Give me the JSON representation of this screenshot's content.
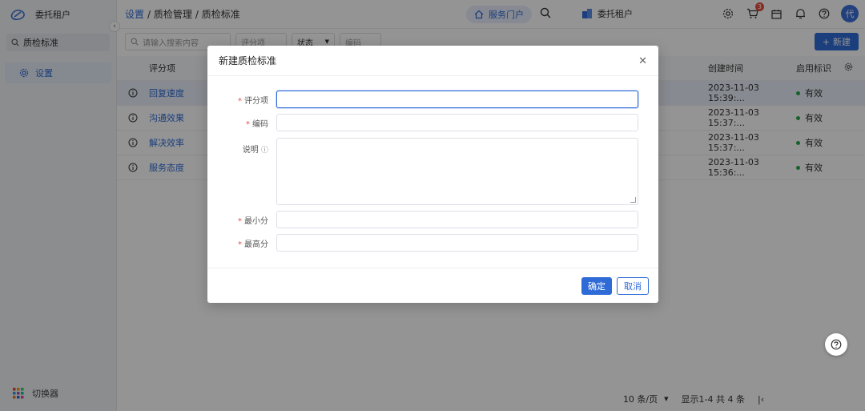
{
  "sidebar": {
    "tenant": "委托租户",
    "search_value": "质检标准",
    "menu_item": "设置",
    "switcher": "切换器"
  },
  "header": {
    "breadcrumb": [
      "设置",
      "/ 质检管理",
      "/ 质检标准"
    ],
    "portal": "服务门户",
    "tenant": "委托租户",
    "cart_badge": "3",
    "avatar": "代"
  },
  "toolbar": {
    "search_placeholder": "请输入搜索内容",
    "filter_score_item": "评分项",
    "filter_status": "状态",
    "filter_code": "编码",
    "new_button": "新建"
  },
  "table": {
    "headers": {
      "name": "评分项",
      "created": "创建时间",
      "flag": "启用标识"
    },
    "rows": [
      {
        "name": "回复速度",
        "created": "2023-11-03 15:39:...",
        "flag": "有效"
      },
      {
        "name": "沟通效果",
        "created": "2023-11-03 15:37:...",
        "flag": "有效"
      },
      {
        "name": "解决效率",
        "created": "2023-11-03 15:37:...",
        "flag": "有效"
      },
      {
        "name": "服务态度",
        "created": "2023-11-03 15:36:...",
        "flag": "有效"
      }
    ]
  },
  "footer": {
    "page_size": "10 条/页",
    "summary": "显示1-4 共 4 条"
  },
  "modal": {
    "title": "新建质检标准",
    "fields": {
      "score_item": "评分项",
      "code": "编码",
      "description": "说明",
      "min_score": "最小分",
      "max_score": "最高分"
    },
    "ok": "确定",
    "cancel": "取消"
  },
  "colors": {
    "primary": "#2f6bd6",
    "required": "#e54d42",
    "status_ok": "#2aa54a"
  }
}
